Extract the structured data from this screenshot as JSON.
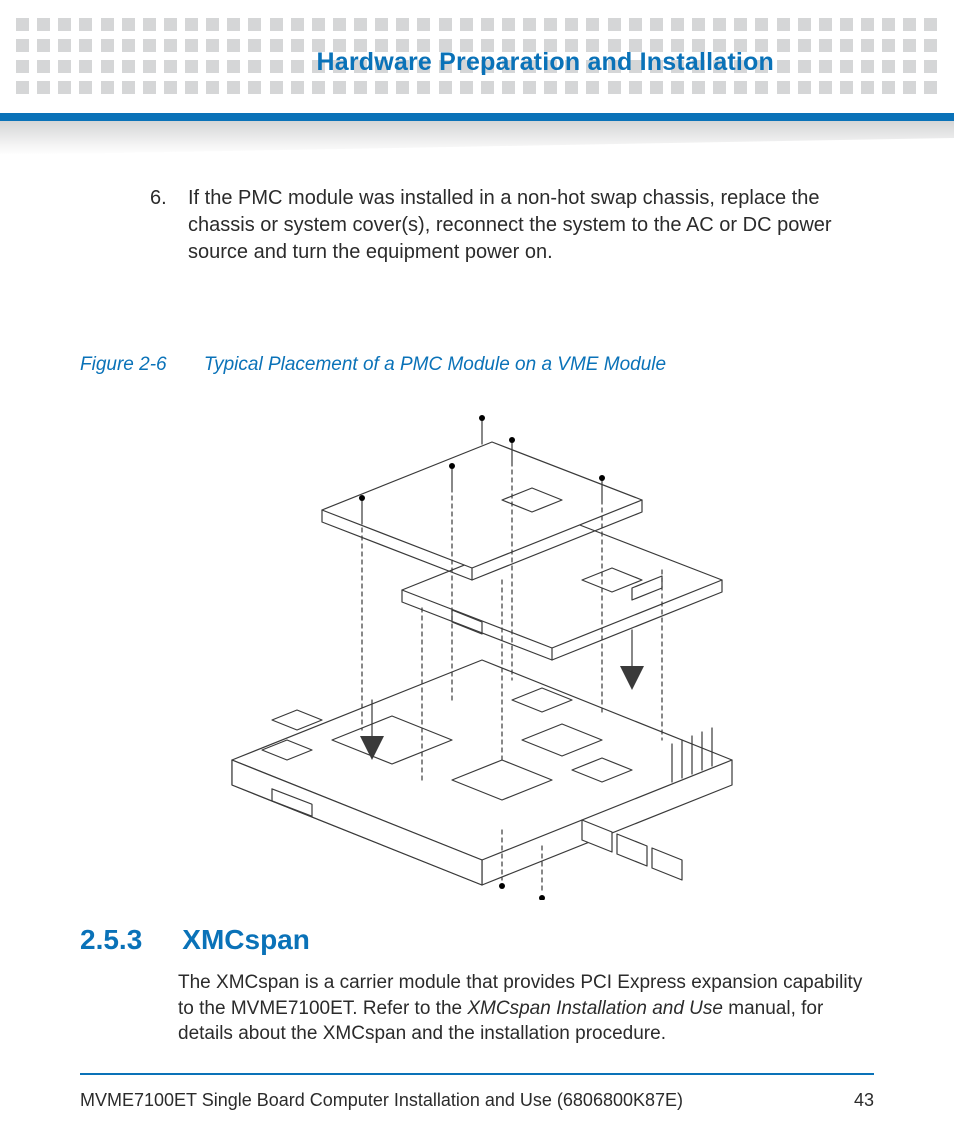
{
  "header": {
    "chapter_title": "Hardware Preparation and Installation"
  },
  "listitem6": {
    "number": "6.",
    "text": "If the PMC module was installed in a non-hot swap chassis, replace the chassis or system cover(s), reconnect the system to the AC or DC power source and turn the equipment power on."
  },
  "figure": {
    "number": "Figure 2-6",
    "caption": "Typical Placement of a PMC Module on a VME Module"
  },
  "section": {
    "number": "2.5.3",
    "title": "XMCspan",
    "para_pre": "The XMCspan is a carrier module that provides PCI Express expansion capability to the MVME7100ET. Refer to the ",
    "para_ital": "XMCspan Installation and Use",
    "para_post": " manual, for details about the XMCspan and the installation procedure."
  },
  "footer": {
    "doc_title": "MVME7100ET Single Board Computer Installation and Use (6806800K87E)",
    "page_number": "43"
  }
}
